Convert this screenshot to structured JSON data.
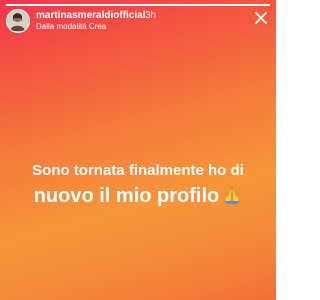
{
  "story": {
    "progress_fraction": 1.0,
    "username": "martinasmeraldiofficial",
    "timestamp": "3h",
    "subtitle": "Dalla modalità Crea",
    "text_line1": "Sono tornata finalmente ho di",
    "text_line2": "nuovo il mio profilo",
    "emoji_icon": "folded-hands-icon",
    "close_icon": "close-icon",
    "colors": {
      "gradient_top": "#f3354f",
      "gradient_mid": "#f6953a",
      "gradient_bottom": "#f26f36",
      "text": "#ffffff"
    }
  }
}
